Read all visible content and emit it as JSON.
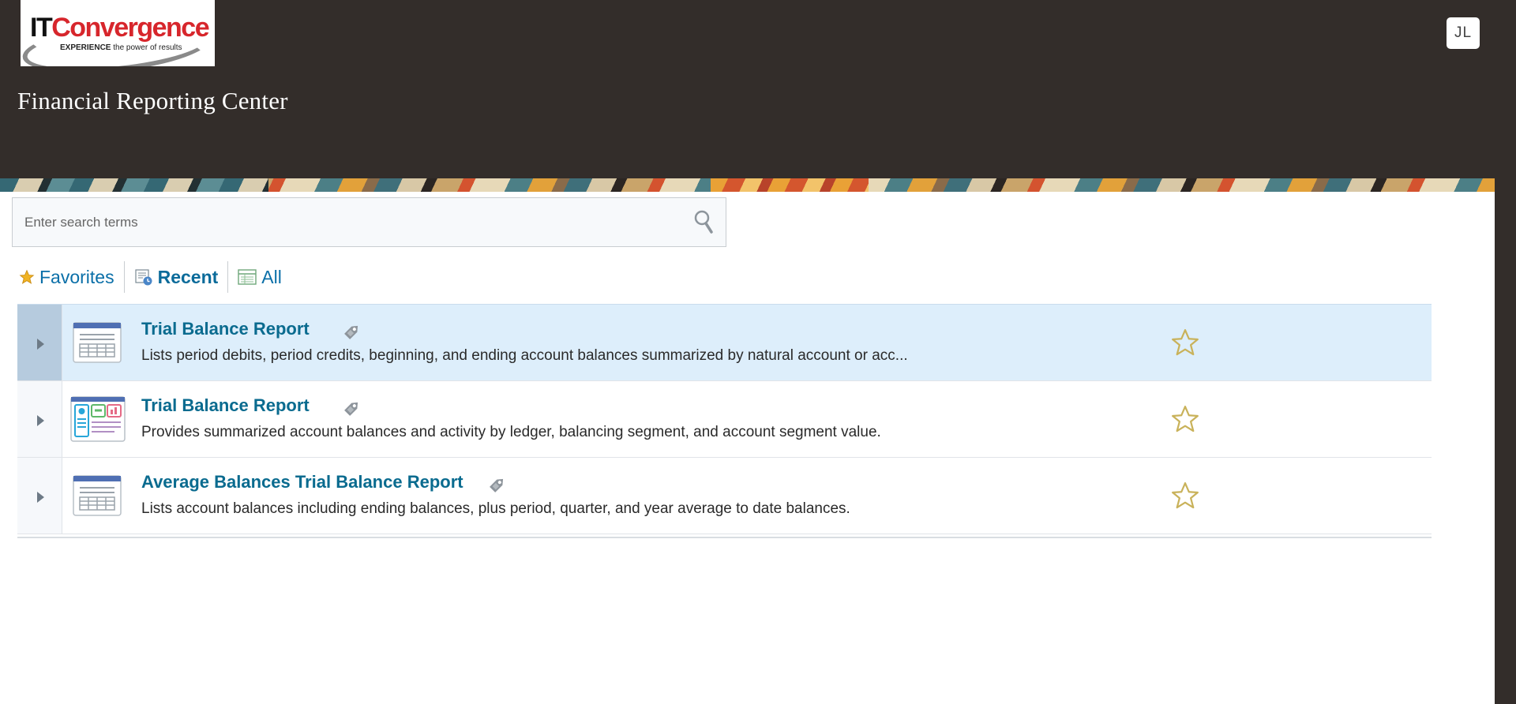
{
  "header": {
    "logo": {
      "brand_it": "IT",
      "brand_c": "Convergence",
      "tagline_bold": "EXPERIENCE",
      "tagline_rest": " the power of results"
    },
    "title": "Financial Reporting Center",
    "user_initials": "JL"
  },
  "search": {
    "placeholder": "Enter search terms",
    "value": ""
  },
  "tabs": [
    {
      "label": "Favorites",
      "icon": "star-icon",
      "active": false
    },
    {
      "label": "Recent",
      "icon": "recent-icon",
      "active": true
    },
    {
      "label": "All",
      "icon": "list-icon",
      "active": false
    }
  ],
  "reports": [
    {
      "title": "Trial Balance Report",
      "description": "Lists period debits, period credits, beginning, and ending account balances summarized by natural account or acc...",
      "icon": "report-table-icon",
      "selected": true
    },
    {
      "title": "Trial Balance Report",
      "description": "Provides summarized account balances and activity by ledger, balancing segment, and account segment value.",
      "icon": "report-dashboard-icon",
      "selected": false
    },
    {
      "title": "Average Balances Trial Balance Report",
      "description": "Lists account balances including ending balances, plus period, quarter, and year average to date balances.",
      "icon": "report-table-icon",
      "selected": false
    }
  ],
  "colors": {
    "header_bg": "#332d2a",
    "link": "#0a6b8f",
    "selected_row": "#ddeefb"
  }
}
